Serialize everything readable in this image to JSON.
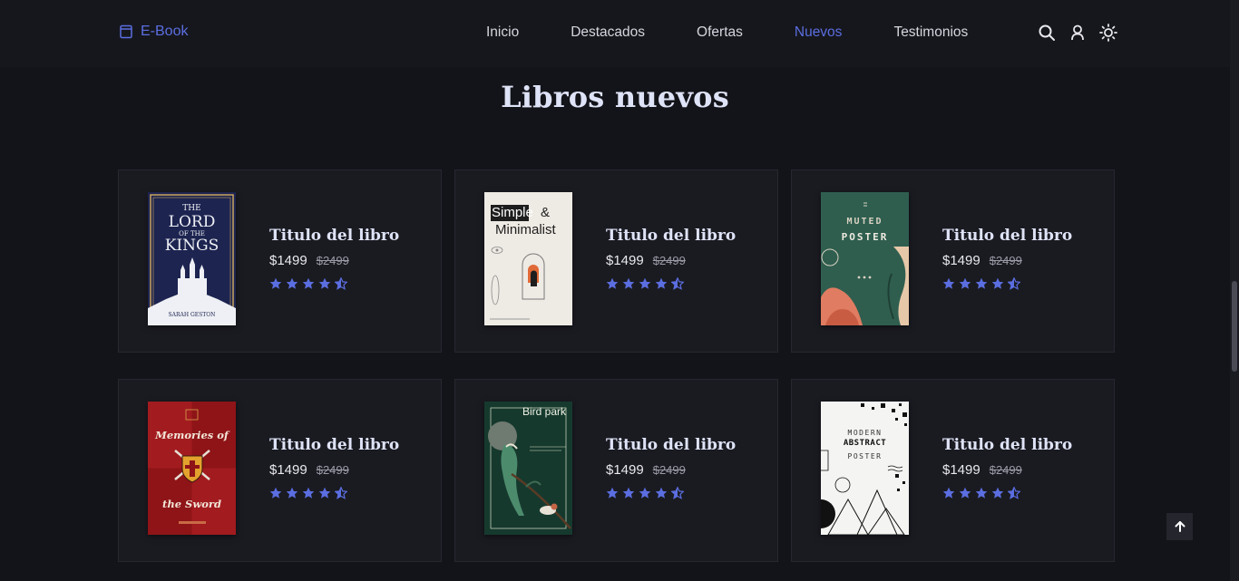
{
  "header": {
    "logo_label": "E-Book",
    "nav": [
      {
        "label": "Inicio",
        "active": false
      },
      {
        "label": "Destacados",
        "active": false
      },
      {
        "label": "Ofertas",
        "active": false
      },
      {
        "label": "Nuevos",
        "active": true
      },
      {
        "label": "Testimonios",
        "active": false
      }
    ],
    "icons": [
      "search-icon",
      "user-icon",
      "sun-icon"
    ]
  },
  "section": {
    "title": "Libros nuevos"
  },
  "books": [
    {
      "title": "Titulo del libro",
      "price": "$1499",
      "old_price": "$2499",
      "rating": 4.5,
      "cover": {
        "line1": "THE",
        "line2": "LORD",
        "line3": "OF THE",
        "line4": "KINGS",
        "author": "SARAH GESTON"
      }
    },
    {
      "title": "Titulo del libro",
      "price": "$1499",
      "old_price": "$2499",
      "rating": 4.5,
      "cover": {
        "line1": "Simple",
        "line2": "&",
        "line3": "Minimalist"
      }
    },
    {
      "title": "Titulo del libro",
      "price": "$1499",
      "old_price": "$2499",
      "rating": 4.5,
      "cover": {
        "line1": "MUTED",
        "line2": "POSTER"
      }
    },
    {
      "title": "Titulo del libro",
      "price": "$1499",
      "old_price": "$2499",
      "rating": 4.5,
      "cover": {
        "line1": "Memories of",
        "line2": "the Sword"
      }
    },
    {
      "title": "Titulo del libro",
      "price": "$1499",
      "old_price": "$2499",
      "rating": 4.5,
      "cover": {
        "line1": "Bird park"
      }
    },
    {
      "title": "Titulo del libro",
      "price": "$1499",
      "old_price": "$2499",
      "rating": 4.5,
      "cover": {
        "line1": "MODERN",
        "line2": "ABSTRACT",
        "line3": "POSTER"
      }
    }
  ],
  "colors": {
    "accent": "#5b6ee1",
    "background": "#131419",
    "card": "#1a1b21",
    "star": "#5b6ee1"
  }
}
